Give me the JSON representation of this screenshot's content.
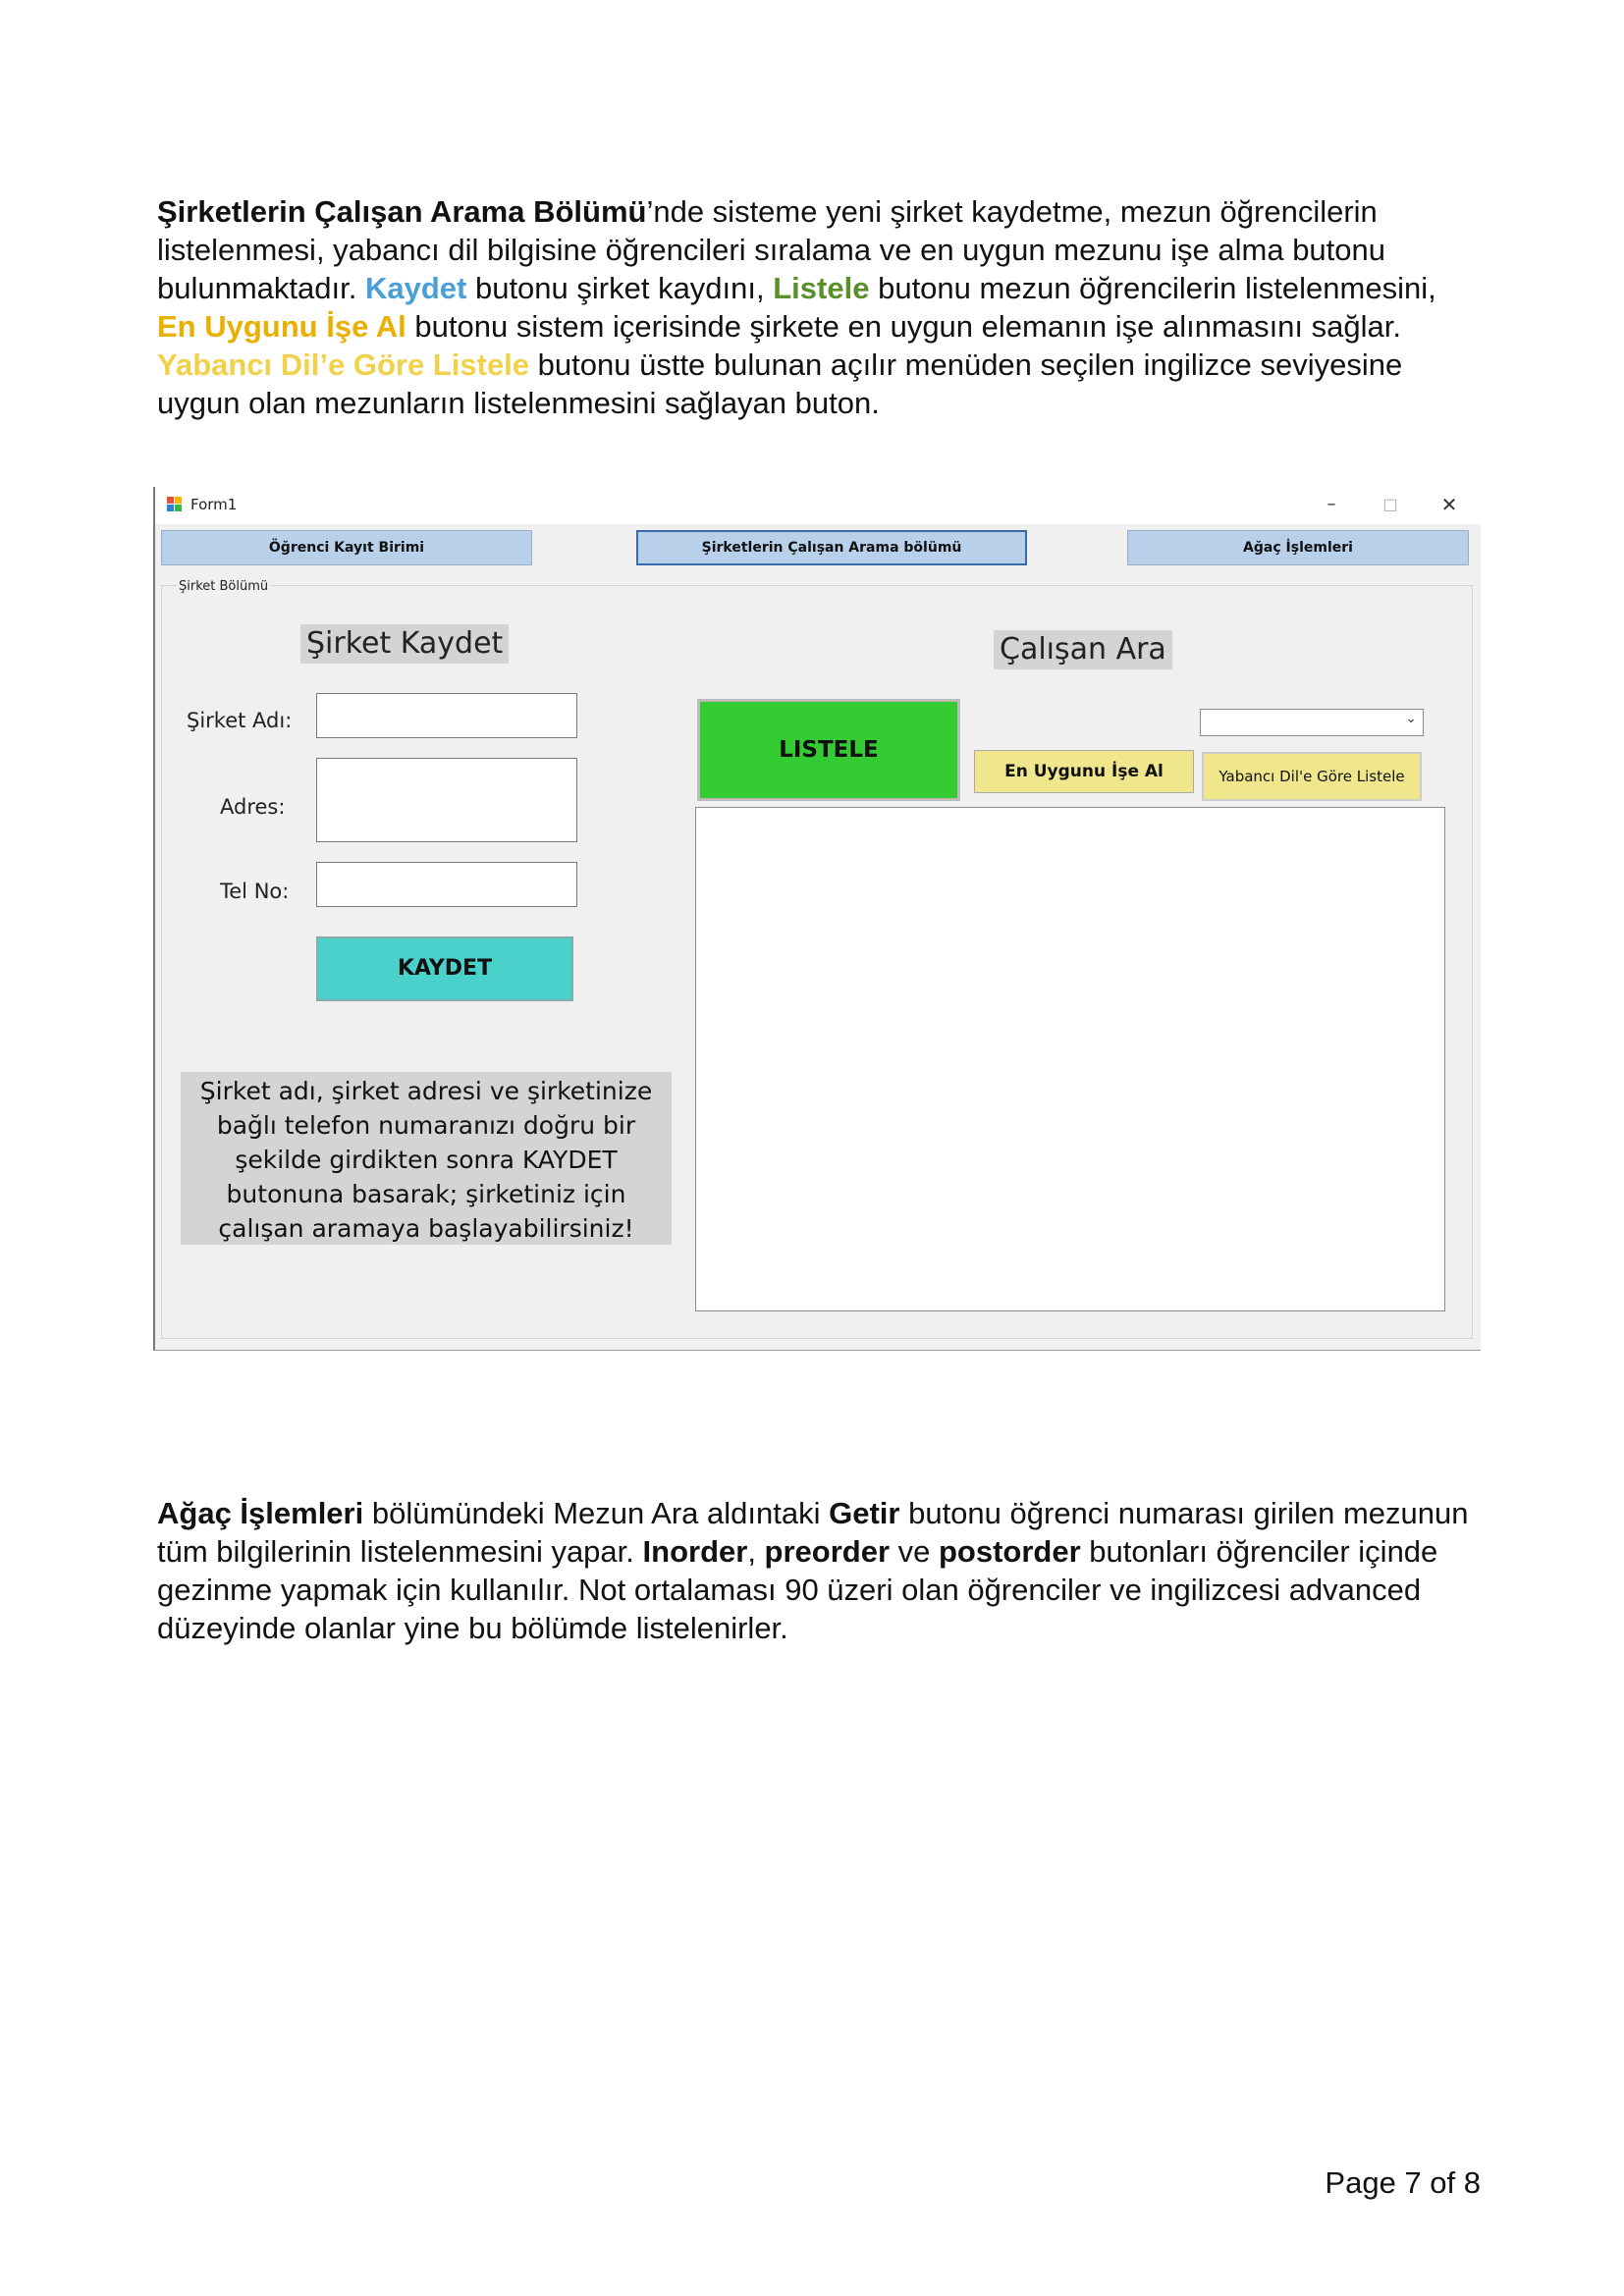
{
  "para1": {
    "b1": "Şirketlerin Çalışan Arama Bölümü",
    "t1": "’nde sisteme yeni şirket kaydetme, mezun öğrencilerin listelenmesi, yabancı dil bilgisine öğrencileri sıralama ve en uygun mezunu işe alma butonu bulunmaktadır. ",
    "kaydet": "Kaydet",
    "t2": " butonu şirket kaydını, ",
    "listele": "Listele",
    "t3": " butonu mezun öğrencilerin listelenmesini, ",
    "uygun": "En Uygunu İşe Al",
    "t4": " butonu sistem içerisinde şirkete en uygun elemanın işe alınmasını sağlar. ",
    "yabanci": "Yabancı Dil’e Göre Listele",
    "t5": " butonu üstte bulunan açılır menüden seçilen ingilizce seviyesine uygun olan mezunların listelenmesini sağlayan buton."
  },
  "window": {
    "title": "Form1",
    "min": "–",
    "max": "□",
    "close": "✕",
    "tabs": [
      "Öğrenci Kayıt Birimi",
      "Şirketlerin Çalışan Arama bölümü",
      "Ağaç İşlemleri"
    ],
    "group_label": "Şirket Bölümü",
    "kaydet_heading": "Şirket Kaydet",
    "ara_heading": "Çalışan Ara",
    "label_ad": "Şirket Adı:",
    "label_adres": "Adres:",
    "label_tel": "Tel No:",
    "btn_kaydet": "KAYDET",
    "btn_listele": "LISTELE",
    "btn_uygun": "En Uygunu İşe Al",
    "btn_yabanci": "Yabancı Dil'e Göre Listele",
    "combo_arrow": "⌄",
    "info": "Şirket adı, şirket adresi ve şirketinize\nbağlı telefon numaranızı doğru bir\nşekilde girdikten sonra KAYDET\nbutonuna basarak; şirketiniz için\nçalışan aramaya başlayabilirsiniz!"
  },
  "para2": {
    "b1": "Ağaç İşlemleri",
    "t1": " bölümündeki Mezun Ara aldıntaki ",
    "b2": "Getir",
    "t2": " butonu öğrenci numarası girilen mezunun tüm bilgilerinin listelenmesini yapar. ",
    "b3": "Inorder",
    "t3": ", ",
    "b4": "preorder",
    "t4": " ve ",
    "b5": "postorder",
    "t5": " butonları öğrenciler içinde gezinme yapmak için kullanılır. Not ortalaması 90 üzeri olan öğrenciler ve ingilizcesi advanced düzeyinde olanlar yine bu bölümde listelenirler."
  },
  "page_number": "Page 7 of 8",
  "colors": {
    "kaydet_text": "#4a9fd6",
    "listele_text": "#5a8f2a",
    "uygun_text": "#e8b000",
    "yabanci_text": "#f2d14a",
    "listele_button": "#33cc33",
    "kaydet_button": "#4ad1cc",
    "yellow_button": "#f0e68c",
    "tab": "#b8d0ea"
  }
}
